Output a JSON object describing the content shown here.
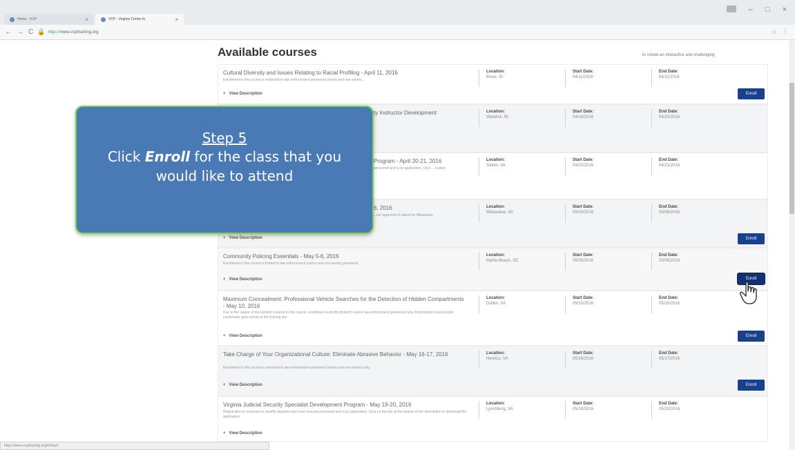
{
  "browser": {
    "tabs": [
      {
        "label": "Home - VCP"
      },
      {
        "label": "VCP - Virginia Center fo"
      }
    ],
    "url_scheme": "https://",
    "url_host": "www.vcpitraining.org",
    "status_url": "https://www.vcpitraining.org/Default"
  },
  "page": {
    "title": "Available courses",
    "intro_snippet": "to create an interactive and challenging"
  },
  "labels": {
    "location": "Location:",
    "start_date": "Start Date:",
    "end_date": "End Date:",
    "view_description": "View Description",
    "enroll": "Enroll"
  },
  "courses": [
    {
      "title": "Cultural Diversity and Issues Relating to Racial Profiling - April 11, 2016",
      "desc": "Enrollment in this course is restricted to law enforcement personnel (sworn and non-sworn).",
      "location": "Boise, ID",
      "start": "04/11/2016",
      "end": "04/11/2016",
      "enroll": true
    },
    {
      "title": "ty Instructor Development",
      "desc": "",
      "location": "Warwick, RI",
      "start": "04/18/2016",
      "end": "04/20/2016",
      "enroll": false
    },
    {
      "title": "Program - April 20-21, 2016",
      "desc": "personnel and is by application. Click ... ication.",
      "location": "Salem, VA",
      "start": "04/20/2016",
      "end": "04/21/2016",
      "enroll": false
    },
    {
      "title": "6, 2016",
      "desc": "...nel approved to attend by Milwaukee",
      "location": "Milwaukee, WI",
      "start": "05/03/2016",
      "end": "05/06/2016",
      "enroll": true
    },
    {
      "title": "Community Policing Essentials - May 5-6, 2016",
      "desc": "Enrollment in this course is limited to law enforcement (sworn and non-sworn) personnel.",
      "location": "Myrtle Beach, SC",
      "start": "05/05/2016",
      "end": "05/06/2016",
      "enroll": true
    },
    {
      "title": "Maximum Concealment: Professional Vehicle Searches for the Detection of Hidden Compartments - May 10, 2016",
      "desc": "Due to the nature of the content covered in this course, enrollment is strictly limited to sworn law enforcement personnel only. Participants must provide credentials upon arrival at the training site.",
      "location": "Dublin, VA",
      "start": "05/10/2016",
      "end": "05/10/2016",
      "enroll": true
    },
    {
      "title": "Take Charge of Your Organizational Culture: Eliminate Abrasive Behavior - May 16-17, 2016",
      "desc": "Enrollment in this course is restricted to law enforcement personnel (sworn and non-sworn) only.",
      "location": "Henrico, VA",
      "start": "05/16/2016",
      "end": "05/17/2016",
      "enroll": true
    },
    {
      "title": "Virginia Judicial Security Specialist Development Program - May 19-20, 2016",
      "desc": "Registration is restricted to sheriffs deputies and court security personnel and is by application. Click on the link at the bottom of the description to download the application.",
      "location": "Lynchburg, VA",
      "start": "05/19/2016",
      "end": "05/20/2016",
      "enroll": false
    }
  ],
  "callout": {
    "step": "Step 5",
    "text_before": "Click ",
    "text_bold": "Enroll",
    "text_after": " for the class that you would like to attend"
  }
}
